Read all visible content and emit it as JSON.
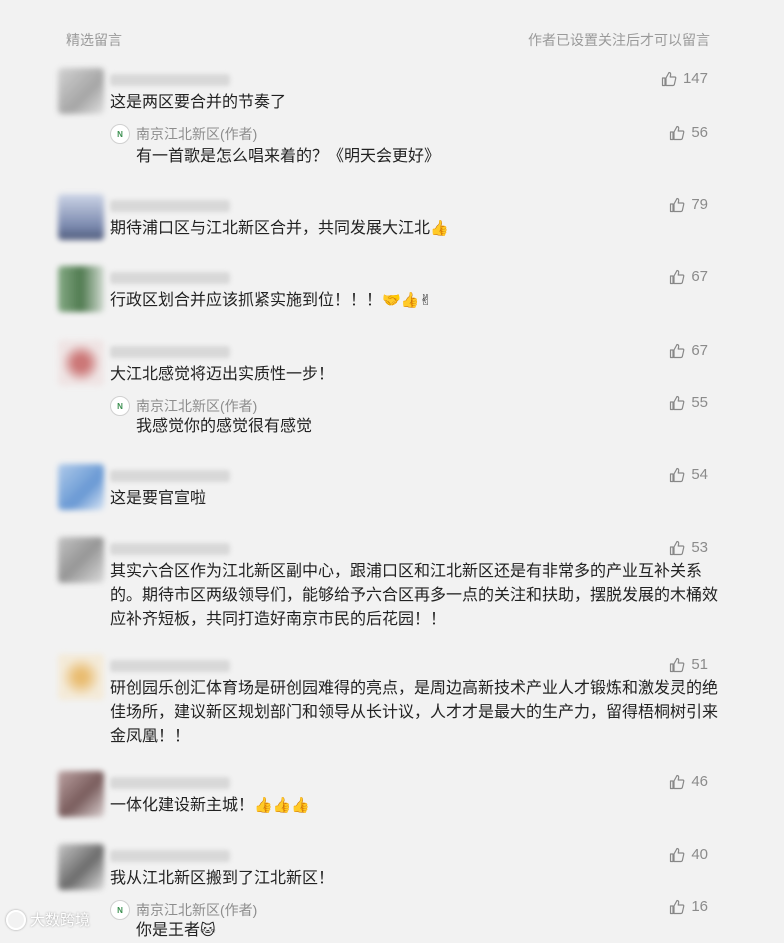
{
  "header": {
    "left": "精选留言",
    "right": "作者已设置关注后才可以留言"
  },
  "comments": [
    {
      "text": "这是两区要合并的节奏了",
      "likes": "147",
      "reply": {
        "author": "南京江北新区(作者)",
        "text": "有一首歌是怎么唱来着的？《明天会更好》",
        "likes": "56"
      }
    },
    {
      "text": "期待浦口区与江北新区合并，共同发展大江北",
      "emoji": "👍",
      "likes": "79"
    },
    {
      "text": "行政区划合并应该抓紧实施到位！！！",
      "emoji": "🤝👍✌",
      "likes": "67"
    },
    {
      "text": "大江北感觉将迈出实质性一步！",
      "likes": "67",
      "reply": {
        "author": "南京江北新区(作者)",
        "text": "我感觉你的感觉很有感觉",
        "likes": "55"
      }
    },
    {
      "text": "这是要官宣啦",
      "likes": "54"
    },
    {
      "text": "其实六合区作为江北新区副中心，跟浦口区和江北新区还是有非常多的产业互补关系的。期待市区两级领导们，能够给予六合区再多一点的关注和扶助，摆脱发展的木桶效应补齐短板，共同打造好南京市民的后花园！！",
      "likes": "53"
    },
    {
      "text": "研创园乐创汇体育场是研创园难得的亮点，是周边高新技术产业人才锻炼和激发灵的绝佳场所，建议新区规划部门和领导从长计议，人才才是最大的生产力，留得梧桐树引来金凤凰！！",
      "likes": "51"
    },
    {
      "text": "一体化建设新主城！",
      "emoji": "👍👍👍",
      "likes": "46"
    },
    {
      "text": "我从江北新区搬到了江北新区！",
      "likes": "40",
      "reply": {
        "author": "南京江北新区(作者)",
        "text": "你是王者",
        "emoji": "🐱",
        "likes": "16"
      }
    }
  ],
  "watermark": "大数跨境",
  "colors": {
    "background": "#f2f2f2",
    "muted": "#8d8d8d",
    "text": "#222222"
  }
}
